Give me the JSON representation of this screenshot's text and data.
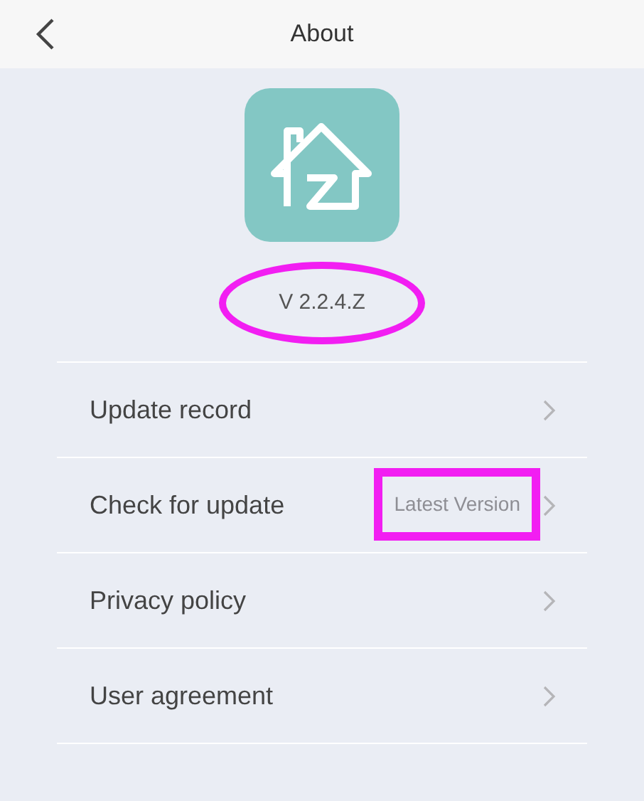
{
  "header": {
    "title": "About"
  },
  "version": "V 2.2.4.Z",
  "items": [
    {
      "label": "Update record"
    },
    {
      "label": "Check for update",
      "value": "Latest Version"
    },
    {
      "label": "Privacy policy"
    },
    {
      "label": "User agreement"
    }
  ]
}
